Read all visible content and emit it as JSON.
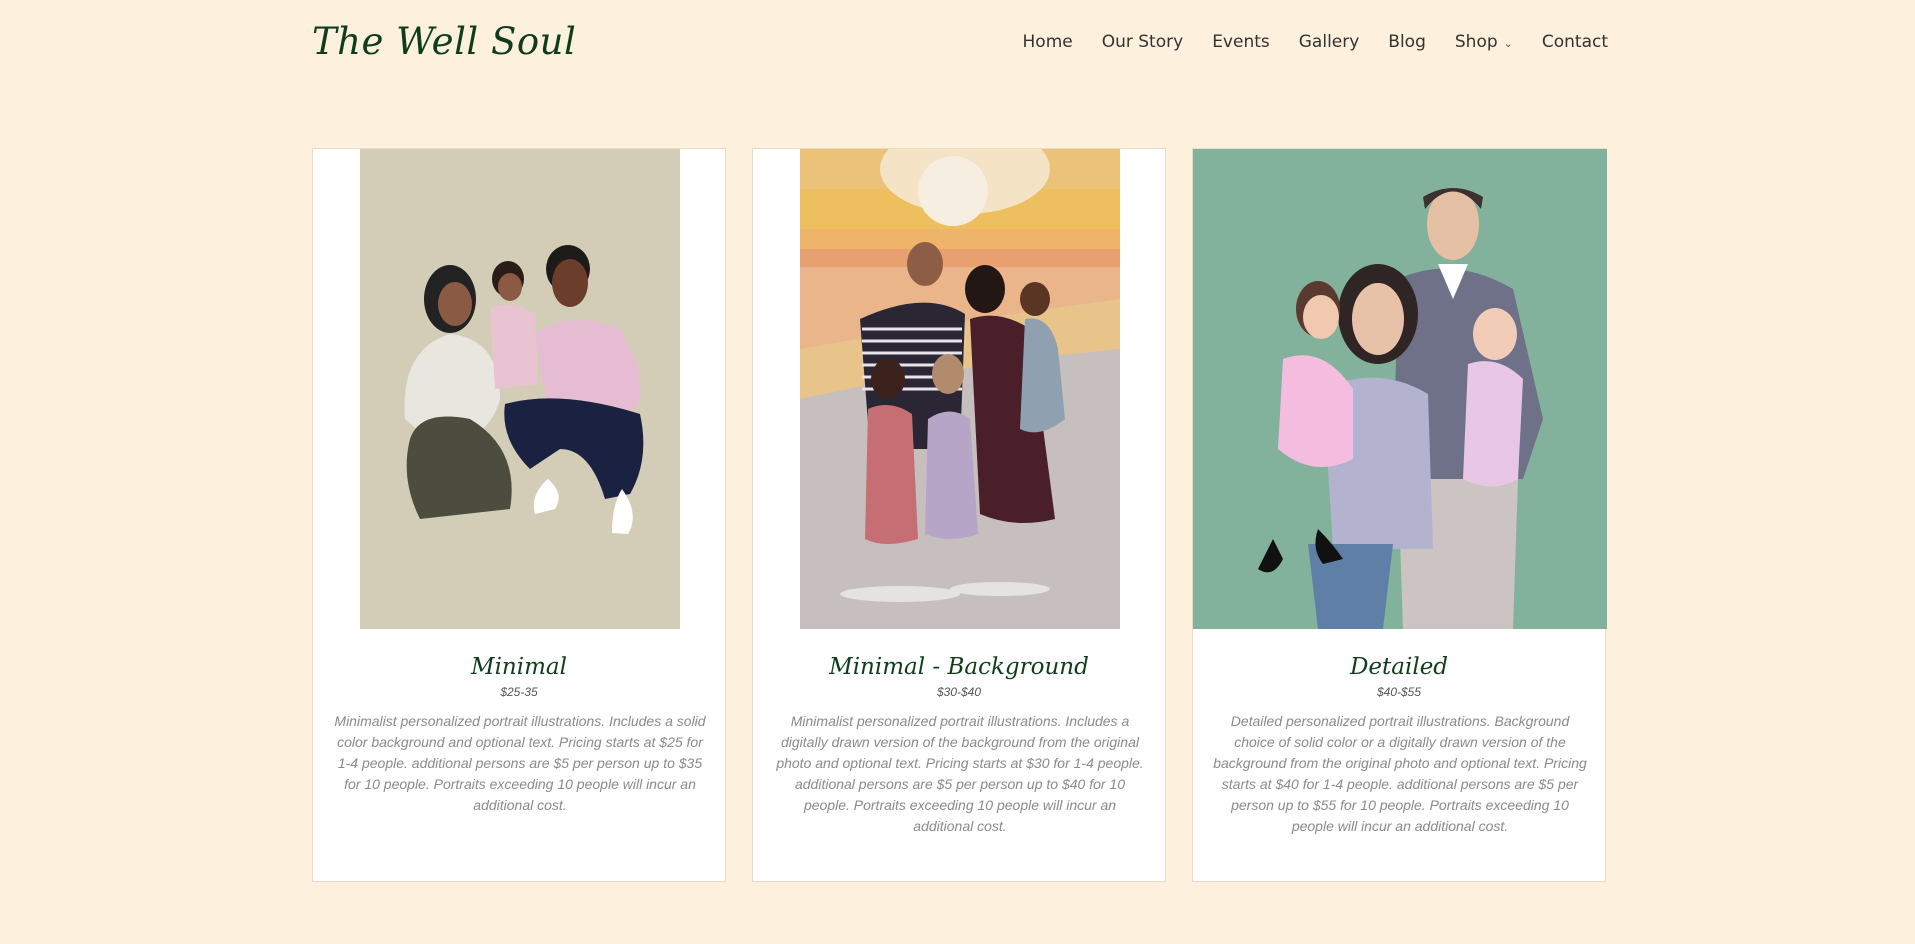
{
  "site": {
    "logo": "The Well Soul",
    "nav": [
      {
        "label": "Home"
      },
      {
        "label": "Our Story"
      },
      {
        "label": "Events"
      },
      {
        "label": "Gallery"
      },
      {
        "label": "Blog"
      },
      {
        "label": "Shop",
        "icon": "chevron-down-icon"
      },
      {
        "label": "Contact"
      }
    ]
  },
  "colors": {
    "background": "#fdf0dc",
    "logo": "#0f3d1a",
    "card_title": "#0f3d1a",
    "description": "#8a8a8a"
  },
  "cards": [
    {
      "title": "Minimal",
      "price": "$25-35",
      "description": "Minimalist personalized portrait illustrations. Includes a solid color background and optional text. Pricing starts at $25 for 1-4 people. additional persons are $5 per person up to $35 for 10 people. Portraits exceeding 10 people will incur an additional cost."
    },
    {
      "title": "Minimal - Background",
      "price": "$30-$40",
      "description": "Minimalist personalized portrait illustrations. Includes a digitally drawn version of the background from the original photo and optional text. Pricing starts at $30 for 1-4 people. additional persons are $5 per person up to $40 for 10 people. Portraits exceeding 10 people will incur an additional cost."
    },
    {
      "title": "Detailed",
      "price": "$40-$55",
      "description": "Detailed personalized portrait illustrations. Background choice of solid color or a digitally drawn version of the background from the original photo and optional text. Pricing starts at $40 for 1-4 people. additional persons are $5 per person up to $55 for 10 people. Portraits exceeding 10 people will incur an additional cost."
    }
  ]
}
